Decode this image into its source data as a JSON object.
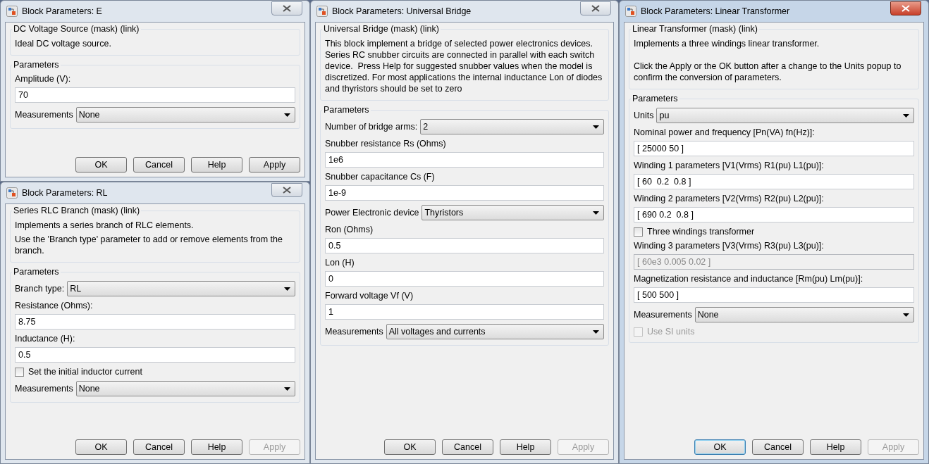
{
  "dialogs": [
    {
      "title": "Block Parameters: E",
      "active": false,
      "description_group": {
        "title": "DC Voltage Source (mask) (link)",
        "paragraphs": [
          "Ideal DC voltage source."
        ]
      },
      "parameters_group": {
        "title": "Parameters",
        "fields": [
          {
            "kind": "edit",
            "label": "Amplitude (V):",
            "value": "70",
            "disabled": false
          },
          {
            "kind": "dropdown",
            "label": "Measurements",
            "value": "None"
          }
        ]
      },
      "buttons": [
        {
          "label": "OK",
          "disabled": false,
          "default": false
        },
        {
          "label": "Cancel",
          "disabled": false,
          "default": false
        },
        {
          "label": "Help",
          "disabled": false,
          "default": false
        },
        {
          "label": "Apply",
          "disabled": false,
          "default": false
        }
      ]
    },
    {
      "title": "Block Parameters: RL",
      "active": false,
      "description_group": {
        "title": "Series RLC Branch (mask) (link)",
        "paragraphs": [
          "Implements a series branch of RLC elements.",
          "Use the 'Branch type' parameter to add or remove elements from the branch."
        ]
      },
      "parameters_group": {
        "title": "Parameters",
        "fields": [
          {
            "kind": "dropdown",
            "label": "Branch type:",
            "value": "RL"
          },
          {
            "kind": "edit",
            "label": "Resistance (Ohms):",
            "value": "8.75",
            "disabled": false
          },
          {
            "kind": "edit",
            "label": "Inductance (H):",
            "value": "0.5",
            "disabled": false
          },
          {
            "kind": "checkbox",
            "label": "Set the initial inductor current",
            "checked": false,
            "disabled": false
          },
          {
            "kind": "dropdown",
            "label": "Measurements",
            "value": "None"
          }
        ]
      },
      "buttons": [
        {
          "label": "OK",
          "disabled": false,
          "default": false
        },
        {
          "label": "Cancel",
          "disabled": false,
          "default": false
        },
        {
          "label": "Help",
          "disabled": false,
          "default": false
        },
        {
          "label": "Apply",
          "disabled": true,
          "default": false
        }
      ]
    },
    {
      "title": "Block Parameters: Universal Bridge",
      "active": false,
      "description_group": {
        "title": "Universal Bridge (mask) (link)",
        "paragraphs": [
          "This block implement a bridge of selected power electronics devices. Series RC snubber circuits are connected in parallel with each switch device.  Press Help for suggested snubber values when the model is discretized. For most applications the internal inductance Lon of diodes and thyristors should be set to zero"
        ]
      },
      "parameters_group": {
        "title": "Parameters",
        "fields": [
          {
            "kind": "dropdown",
            "label": "Number of bridge arms:",
            "value": "2"
          },
          {
            "kind": "edit",
            "label": "Snubber resistance Rs (Ohms)",
            "value": "1e6",
            "disabled": false
          },
          {
            "kind": "edit",
            "label": "Snubber capacitance Cs (F)",
            "value": "1e-9",
            "disabled": false
          },
          {
            "kind": "dropdown",
            "label": "Power Electronic device",
            "value": "Thyristors"
          },
          {
            "kind": "edit",
            "label": "Ron (Ohms)",
            "value": "0.5",
            "disabled": false
          },
          {
            "kind": "edit",
            "label": "Lon (H)",
            "value": "0",
            "disabled": false
          },
          {
            "kind": "edit",
            "label": "Forward voltage Vf (V)",
            "value": "1",
            "disabled": false
          },
          {
            "kind": "dropdown",
            "label": "Measurements",
            "value": "All voltages and currents"
          }
        ]
      },
      "buttons": [
        {
          "label": "OK",
          "disabled": false,
          "default": false
        },
        {
          "label": "Cancel",
          "disabled": false,
          "default": false
        },
        {
          "label": "Help",
          "disabled": false,
          "default": false
        },
        {
          "label": "Apply",
          "disabled": true,
          "default": false
        }
      ]
    },
    {
      "title": "Block Parameters: Linear Transformer",
      "active": true,
      "description_group": {
        "title": "Linear Transformer (mask) (link)",
        "paragraphs": [
          "Implements a three windings linear transformer.",
          "Click the Apply or the OK button after a change to the Units popup to confirm the conversion of parameters."
        ]
      },
      "parameters_group": {
        "title": "Parameters",
        "fields": [
          {
            "kind": "dropdown",
            "label": "Units",
            "value": "pu"
          },
          {
            "kind": "edit",
            "label": "Nominal power and frequency [Pn(VA) fn(Hz)]:",
            "value": "[ 25000 50 ]",
            "disabled": false
          },
          {
            "kind": "edit",
            "label": "Winding 1 parameters [V1(Vrms) R1(pu) L1(pu)]:",
            "value": "[ 60  0.2  0.8 ]",
            "disabled": false
          },
          {
            "kind": "edit",
            "label": "Winding 2 parameters [V2(Vrms) R2(pu) L2(pu)]:",
            "value": "[ 690 0.2  0.8 ]",
            "disabled": false
          },
          {
            "kind": "checkbox",
            "label": "Three windings transformer",
            "checked": false,
            "disabled": false
          },
          {
            "kind": "edit",
            "label": "Winding 3 parameters [V3(Vrms) R3(pu) L3(pu)]:",
            "value": "[ 60e3 0.005 0.02 ]",
            "disabled": true
          },
          {
            "kind": "edit",
            "label": "Magnetization resistance and inductance [Rm(pu) Lm(pu)]:",
            "value": "[ 500 500 ]",
            "disabled": false
          },
          {
            "kind": "dropdown",
            "label": "Measurements",
            "value": "None"
          },
          {
            "kind": "checkbox",
            "label": "Use SI units",
            "checked": false,
            "disabled": true
          }
        ]
      },
      "buttons": [
        {
          "label": "OK",
          "disabled": false,
          "default": true
        },
        {
          "label": "Cancel",
          "disabled": false,
          "default": false
        },
        {
          "label": "Help",
          "disabled": false,
          "default": false
        },
        {
          "label": "Apply",
          "disabled": true,
          "default": false
        }
      ]
    }
  ]
}
